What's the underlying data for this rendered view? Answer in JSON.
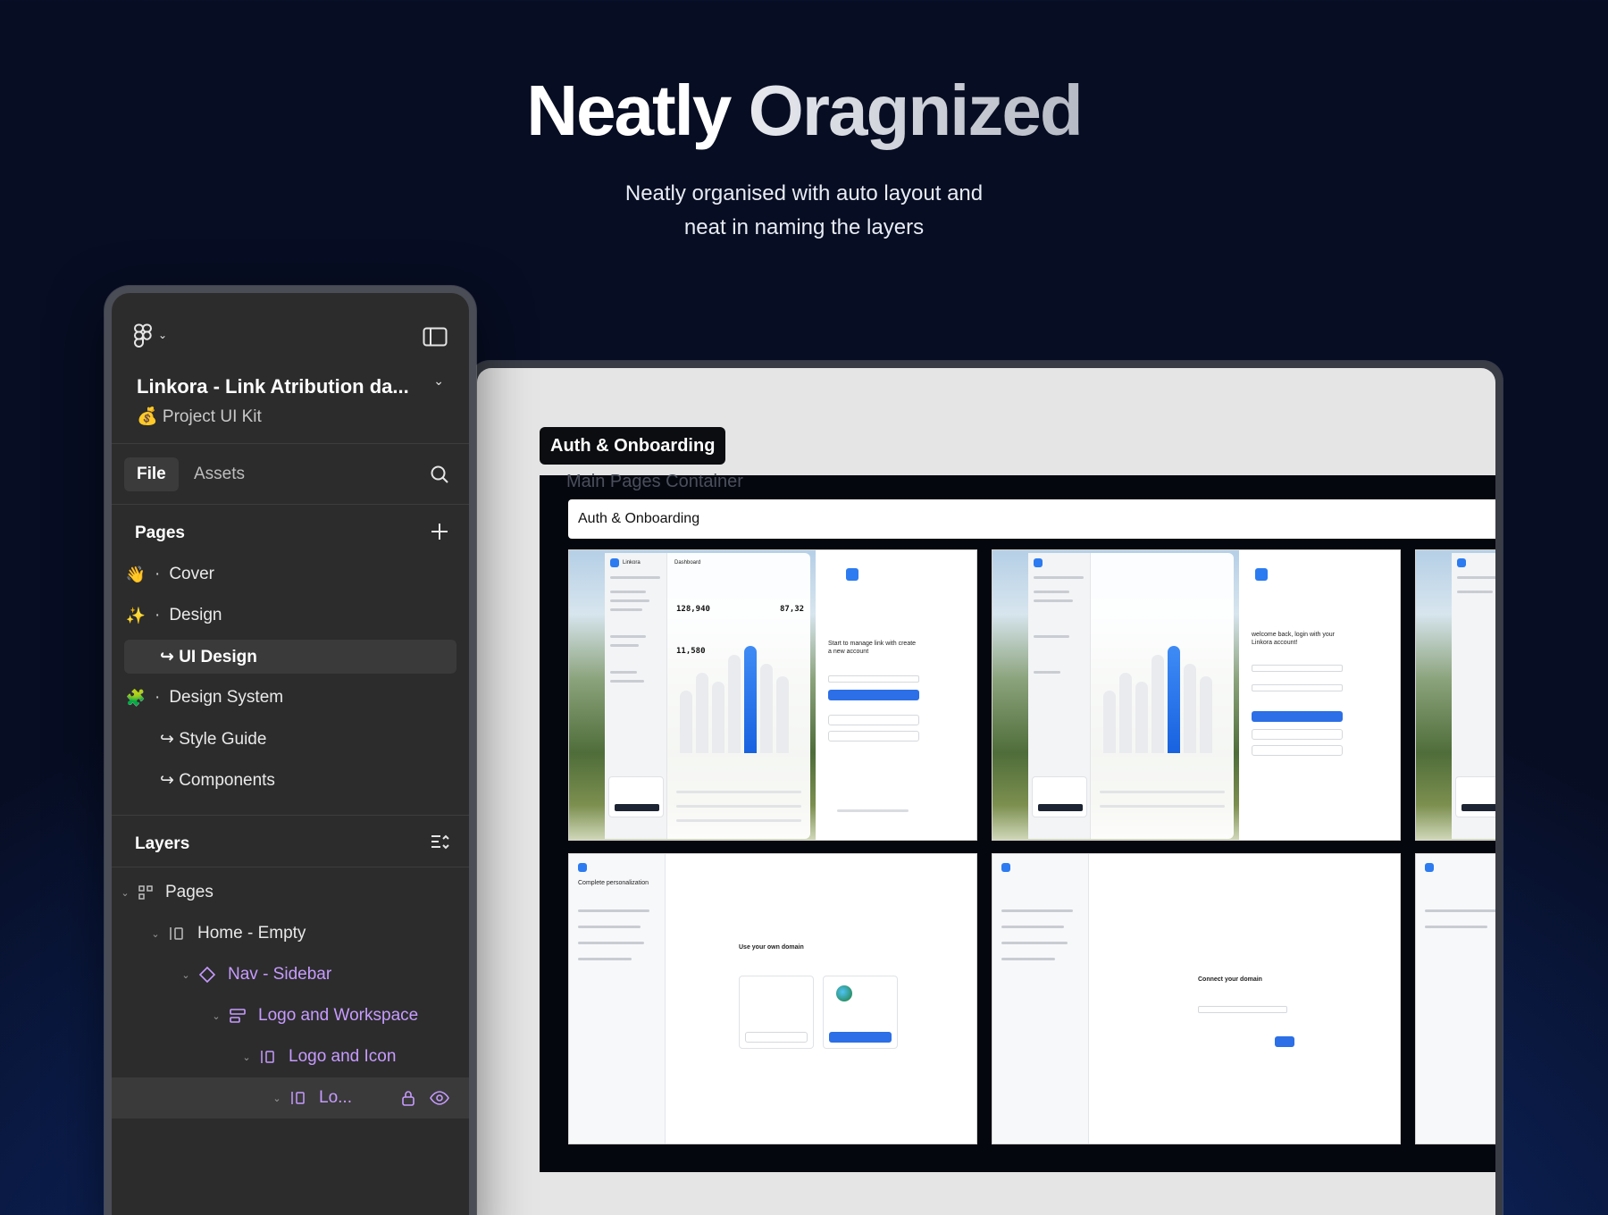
{
  "hero": {
    "title_part1": "Neatly",
    "title_part2": "Oragnized",
    "subtitle_line1": "Neatly organised with auto layout and",
    "subtitle_line2": "neat in naming the layers"
  },
  "figma_panel": {
    "project_title": "Linkora - Link Atribution da...",
    "project_subtitle": "💰 Project UI Kit",
    "tabs": {
      "file": "File",
      "assets": "Assets"
    },
    "pages_title": "Pages",
    "pages": [
      {
        "emoji": "👋",
        "label": "Cover"
      },
      {
        "emoji": "✨",
        "label": "Design"
      },
      {
        "label": "↪ UI Design",
        "selected": true
      },
      {
        "emoji": "🧩",
        "label": "Design System"
      },
      {
        "label": "↪ Style Guide"
      },
      {
        "label": "↪ Components"
      }
    ],
    "layers_title": "Layers",
    "layers": [
      {
        "label": "Pages",
        "icon": "section-icon"
      },
      {
        "label": "Home - Empty",
        "icon": "frame-icon"
      },
      {
        "label": "Nav - Sidebar",
        "icon": "component-icon"
      },
      {
        "label": "Logo and Workspace",
        "icon": "autolayout-icon"
      },
      {
        "label": "Logo and Icon",
        "icon": "frame-icon"
      },
      {
        "label": "Lo...",
        "icon": "frame-icon"
      }
    ]
  },
  "canvas": {
    "frame_badge": "Auth & Onboarding",
    "container_label": "Main Pages Container",
    "section_title": "Auth & Onboarding",
    "signup_heading": "Start to manage link with create a new account",
    "login_heading": "welcome back, login with your Linkora account!",
    "domain_heading": "Use your own domain",
    "connect_heading": "Connect your domain",
    "personalization_heading": "Complete personalization",
    "dashboard_stat1": "128,940",
    "dashboard_stat2": "87,32",
    "dashboard_stat3": "11,580",
    "brand": "Linkora",
    "dashboard_label": "Dashboard"
  }
}
